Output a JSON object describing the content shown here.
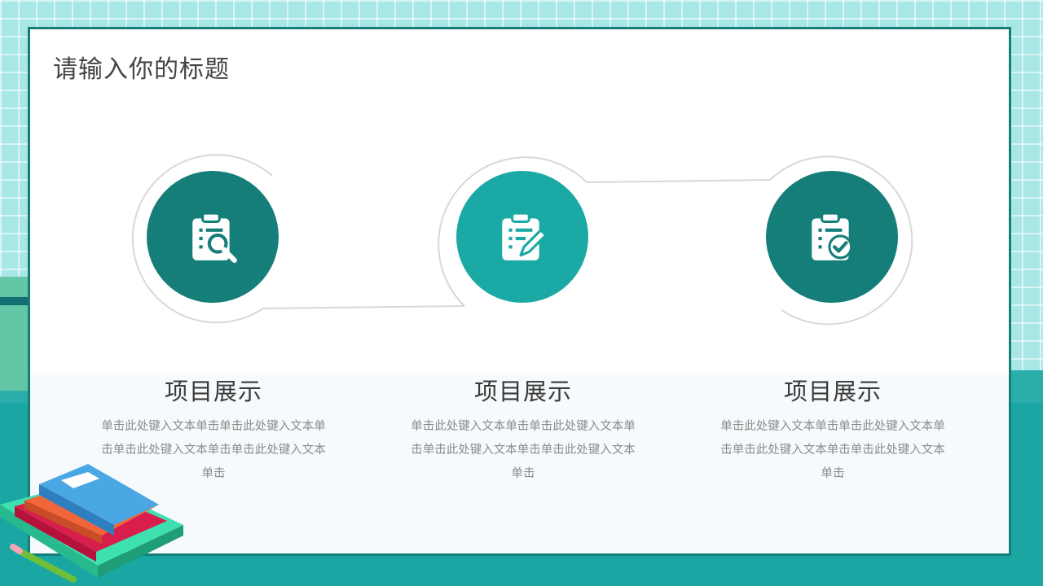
{
  "slide": {
    "title": "请输入你的标题",
    "items": [
      {
        "icon": "clipboard-search-icon",
        "heading": "项目展示",
        "desc1": "单击此处键入文本单击单击此处键入文本单",
        "desc2": "击单击此处键入文本单击单击此处键入文本",
        "desc3": "单击",
        "color": "#167e79"
      },
      {
        "icon": "clipboard-edit-icon",
        "heading": "项目展示",
        "desc1": "单击此处键入文本单击单击此处键入文本单",
        "desc2": "击单击此处键入文本单击单击此处键入文本",
        "desc3": "单击",
        "color": "#1aa9a5"
      },
      {
        "icon": "clipboard-check-icon",
        "heading": "项目展示",
        "desc1": "单击此处键入文本单击单击此处键入文本单",
        "desc2": "击单击此处键入文本单击单击此处键入文本",
        "desc3": "单击",
        "color": "#167e79"
      }
    ]
  },
  "colors": {
    "teal_dark": "#167e79",
    "teal_light": "#1aa9a5",
    "background": "#a9e6e6"
  }
}
